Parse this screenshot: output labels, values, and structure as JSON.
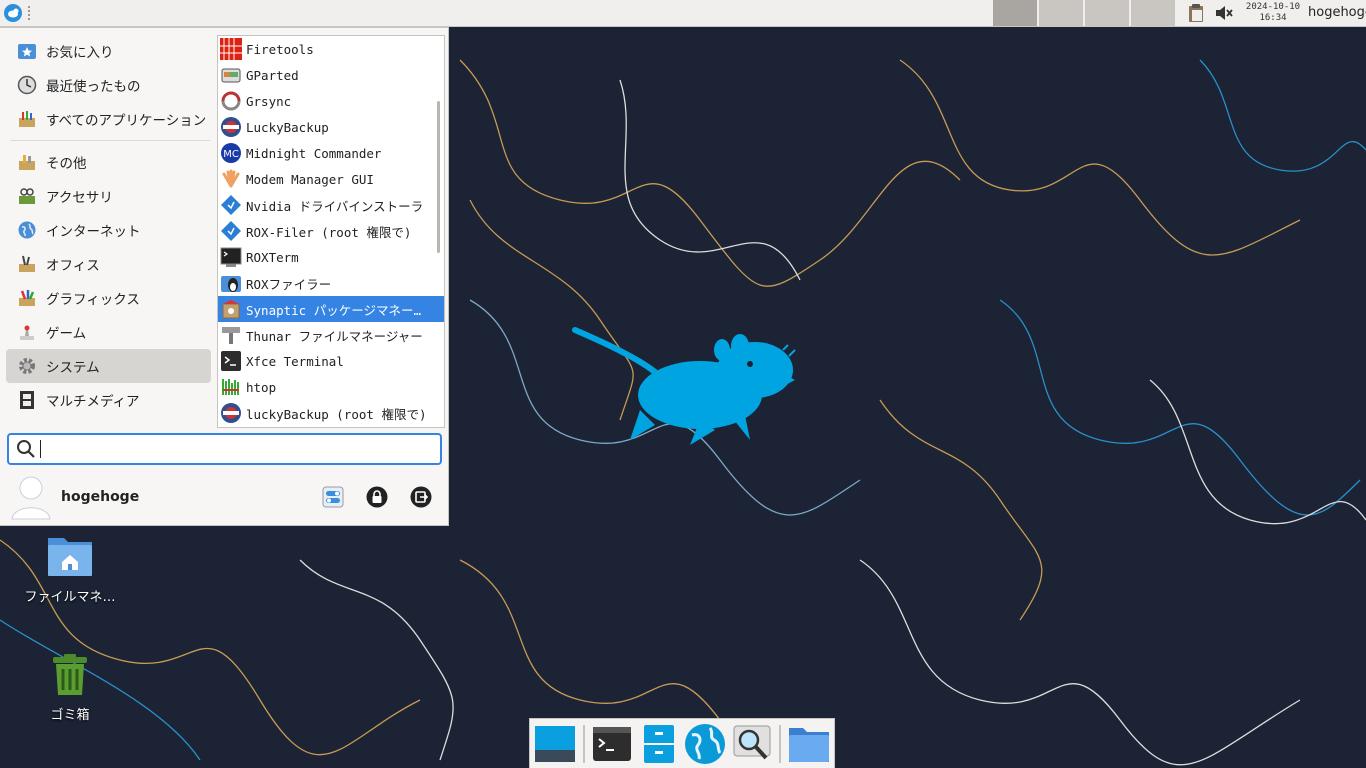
{
  "top_panel": {
    "clock_date": "2024-10-10",
    "clock_time": "16:34",
    "user": "hogehoge",
    "workspaces": [
      "1",
      "2",
      "3",
      "4"
    ]
  },
  "menu": {
    "categories": [
      {
        "label": "お気に入り",
        "icon": "star-folder-icon"
      },
      {
        "label": "最近使ったもの",
        "icon": "clock-icon"
      },
      {
        "label": "すべてのアプリケーション",
        "icon": "all-apps-icon"
      },
      {
        "label": "その他",
        "icon": "misc-icon"
      },
      {
        "label": "アクセサリ",
        "icon": "accessories-icon"
      },
      {
        "label": "インターネット",
        "icon": "globe-icon"
      },
      {
        "label": "オフィス",
        "icon": "office-icon"
      },
      {
        "label": "グラフィックス",
        "icon": "graphics-icon"
      },
      {
        "label": "ゲーム",
        "icon": "game-icon"
      },
      {
        "label": "システム",
        "icon": "gear-icon"
      },
      {
        "label": "マルチメディア",
        "icon": "film-icon"
      }
    ],
    "active_category": "システム",
    "apps": [
      {
        "label": "Firetools"
      },
      {
        "label": "GParted"
      },
      {
        "label": "Grsync"
      },
      {
        "label": "LuckyBackup"
      },
      {
        "label": "Midnight Commander"
      },
      {
        "label": "Modem Manager GUI"
      },
      {
        "label": "Nvidia ドライバインストーラ"
      },
      {
        "label": "ROX-Filer (root 権限で)"
      },
      {
        "label": "ROXTerm"
      },
      {
        "label": "ROXファイラー"
      },
      {
        "label": "Synaptic パッケージマネー…"
      },
      {
        "label": "Thunar ファイルマネージャー"
      },
      {
        "label": "Xfce Terminal"
      },
      {
        "label": "htop"
      },
      {
        "label": "luckyBackup (root 権限で)"
      }
    ],
    "selected_app": "Synaptic パッケージマネー…",
    "search": {
      "value": "",
      "placeholder": ""
    },
    "user_name": "hogehoge"
  },
  "desktop": {
    "icons": [
      {
        "label": "ファイルマネ…",
        "icon": "home-folder-icon"
      },
      {
        "label": "ゴミ箱",
        "icon": "trash-icon"
      }
    ]
  },
  "dock": {
    "items": [
      "show-desktop",
      "terminal",
      "file-cabinet",
      "web-browser",
      "app-finder",
      "files"
    ]
  },
  "colors": {
    "accent": "#3584e4",
    "desktop_bg": "#1a2233",
    "xfce_mouse": "#00a4e0"
  }
}
